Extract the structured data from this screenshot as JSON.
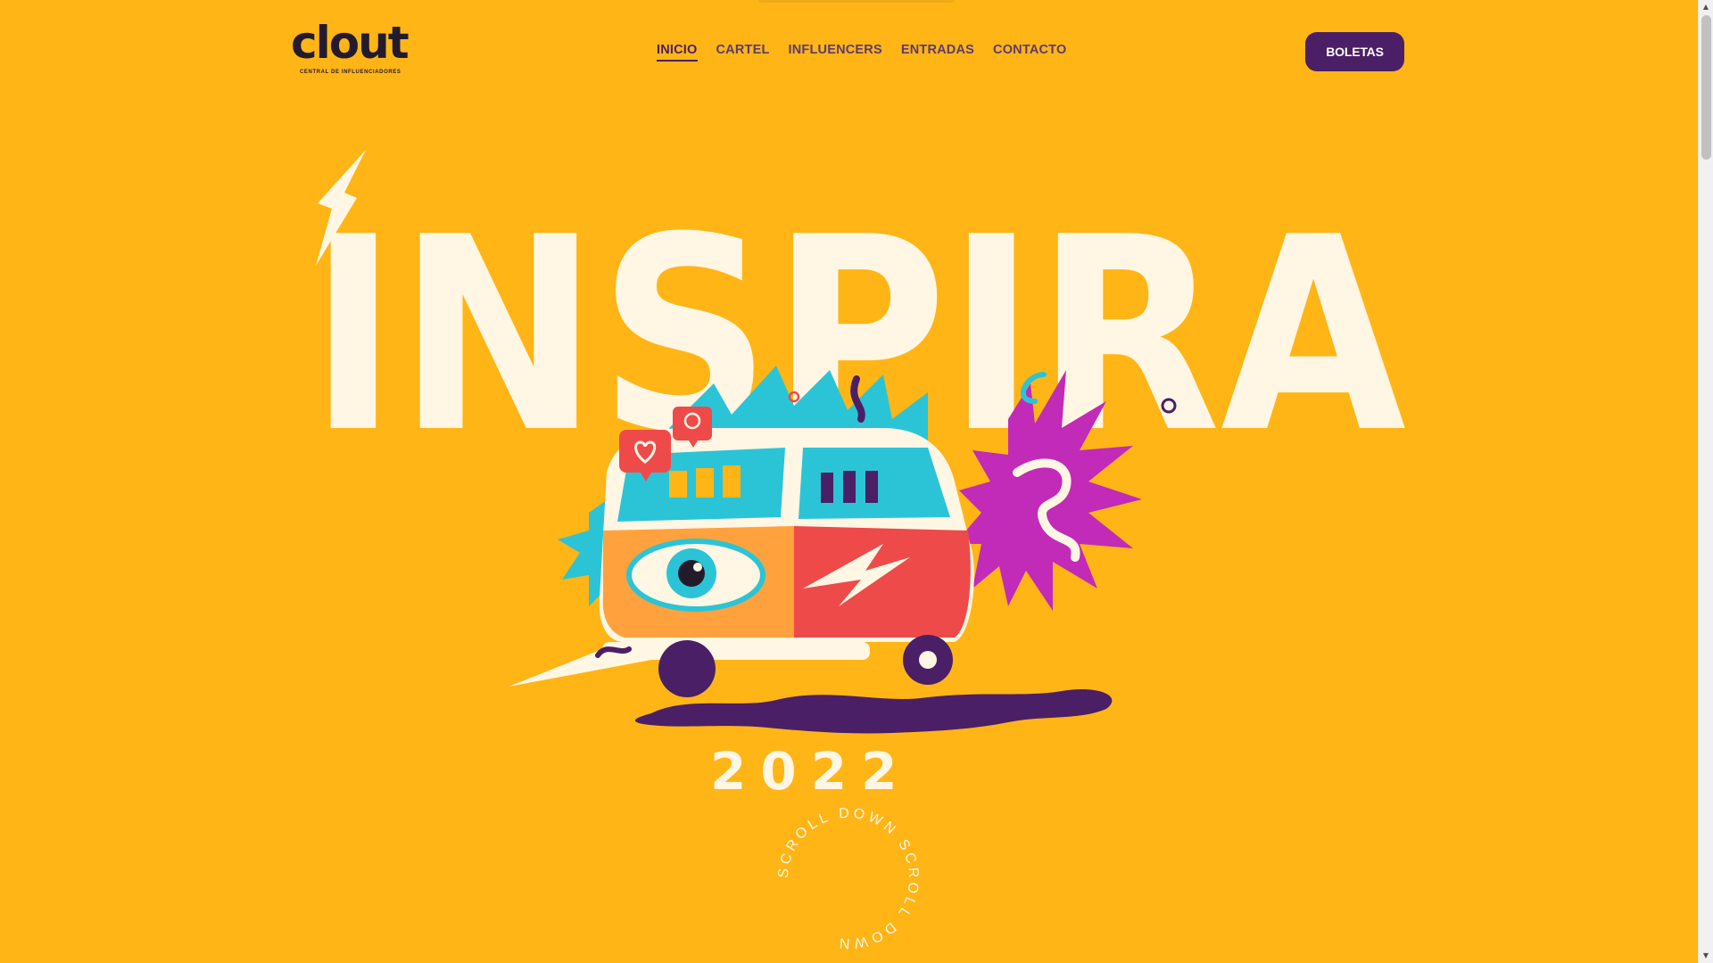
{
  "brand": {
    "logo_text": "clout",
    "tagline": "CENTRAL DE INFLUENCIADORES"
  },
  "nav": {
    "items": [
      {
        "label": "INICIO",
        "active": true
      },
      {
        "label": "CARTEL",
        "active": false
      },
      {
        "label": "INFLUENCERS",
        "active": false
      },
      {
        "label": "ENTRADAS",
        "active": false
      },
      {
        "label": "CONTACTO",
        "active": false
      }
    ]
  },
  "cta": {
    "label": "BOLETAS"
  },
  "hero": {
    "title": "INSPIRA",
    "year": "2022",
    "scroll_text": "SCROLL DOWN SCROLL DOWN"
  },
  "colors": {
    "background": "#FFB516",
    "cream": "#FFF6E3",
    "purple": "#4A1F66",
    "dark": "#231B2C",
    "teal": "#2BC4D6",
    "magenta": "#C22AB8",
    "red": "#EE4A4A"
  },
  "icons": {
    "heart": "heart-icon",
    "chat": "chat-bubble-icon",
    "bolt": "lightning-bolt-icon"
  }
}
